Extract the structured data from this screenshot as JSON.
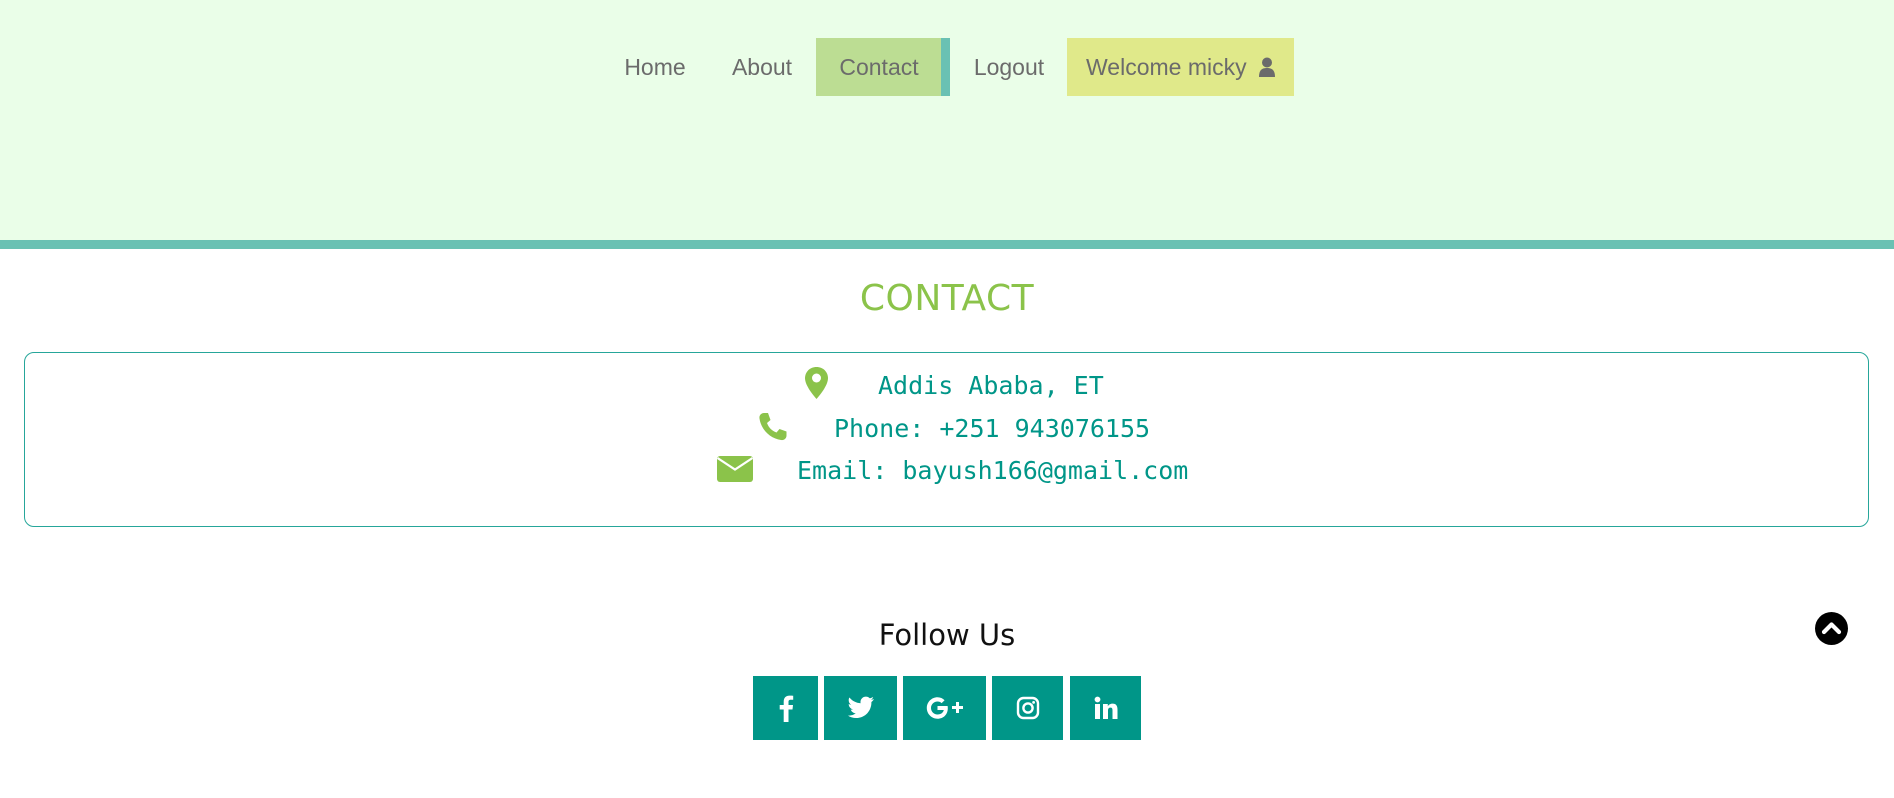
{
  "nav": {
    "items": [
      {
        "label": "Home"
      },
      {
        "label": "About"
      },
      {
        "label": "Contact",
        "active": true
      },
      {
        "label": "Logout"
      }
    ],
    "welcome": {
      "label": "Welcome micky",
      "icon": "user-icon"
    }
  },
  "contact": {
    "title": "CONTACT",
    "address": {
      "text": "Addis Ababa, ET",
      "icon": "map-marker-icon"
    },
    "phone": {
      "text": "Phone: +251 943076155",
      "icon": "phone-icon"
    },
    "email": {
      "text": "Email: bayush166@gmail.com",
      "icon": "envelope-icon"
    }
  },
  "follow": {
    "title": "Follow Us",
    "links": [
      {
        "icon": "facebook-icon"
      },
      {
        "icon": "twitter-icon"
      },
      {
        "icon": "google-plus-icon"
      },
      {
        "icon": "instagram-icon"
      },
      {
        "icon": "linkedin-icon"
      }
    ]
  },
  "scroll_top": {
    "icon": "chevron-up-circle-icon"
  },
  "colors": {
    "header_bg": "#eafee8",
    "accent_teal": "#009688",
    "accent_green": "#8bc34a",
    "active_nav_bg": "#bcdd93",
    "welcome_bg": "#e0e98a",
    "border_teal": "#6ac1b3"
  }
}
